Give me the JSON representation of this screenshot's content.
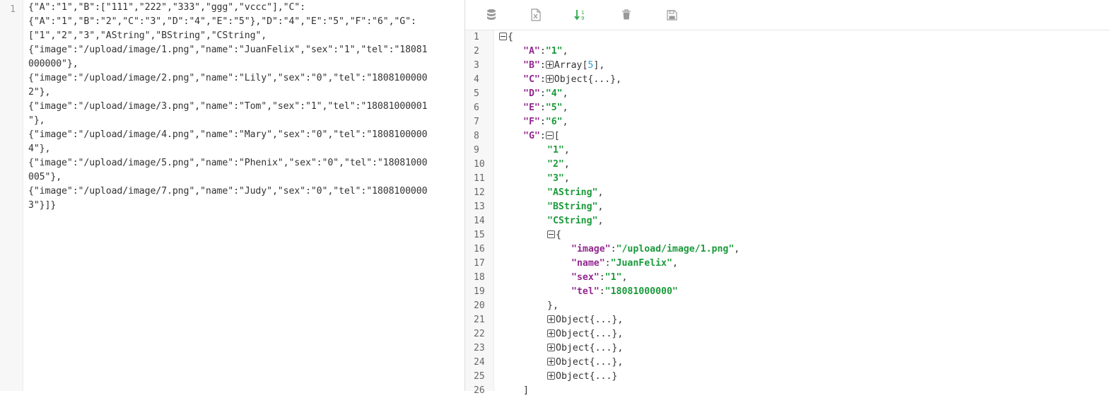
{
  "left_editor": {
    "line_number": "1",
    "rows": [
      "{\"A\":\"1\",\"B\":[\"111\",\"222\",\"333\",\"ggg\",\"vccc\"],\"C\":",
      "{\"A\":\"1\",\"B\":\"2\",\"C\":\"3\",\"D\":\"4\",\"E\":\"5\"},\"D\":\"4\",\"E\":\"5\",\"F\":\"6\",\"G\":",
      "[\"1\",\"2\",\"3\",\"AString\",\"BString\",\"CString\",",
      "{\"image\":\"/upload/image/1.png\",\"name\":\"JuanFelix\",\"sex\":\"1\",\"tel\":\"18081",
      "000000\"},",
      "{\"image\":\"/upload/image/2.png\",\"name\":\"Lily\",\"sex\":\"0\",\"tel\":\"1808100000",
      "2\"},",
      "{\"image\":\"/upload/image/3.png\",\"name\":\"Tom\",\"sex\":\"1\",\"tel\":\"18081000001",
      "\"},",
      "{\"image\":\"/upload/image/4.png\",\"name\":\"Mary\",\"sex\":\"0\",\"tel\":\"1808100000",
      "4\"},",
      "{\"image\":\"/upload/image/5.png\",\"name\":\"Phenix\",\"sex\":\"0\",\"tel\":\"18081000",
      "005\"},",
      "{\"image\":\"/upload/image/7.png\",\"name\":\"Judy\",\"sex\":\"0\",\"tel\":\"1808100000",
      "3\"}]}"
    ]
  },
  "toolbar": {
    "icons": [
      "database-icon",
      "excel-export-icon",
      "sort-icon",
      "trash-icon",
      "save-icon"
    ],
    "accent_color": "#2eaa4a",
    "icon_color": "#999999"
  },
  "colors": {
    "key": "#92278f",
    "string": "#1a9a3a",
    "number": "#25a4d6"
  },
  "tree": {
    "line_numbers": [
      "1",
      "2",
      "3",
      "4",
      "5",
      "6",
      "7",
      "8",
      "9",
      "10",
      "11",
      "12",
      "13",
      "14",
      "15",
      "16",
      "17",
      "18",
      "19",
      "20",
      "21",
      "22",
      "23",
      "24",
      "25",
      "26"
    ],
    "lines": [
      {
        "indent": 0,
        "toggle": "minus",
        "punct": "{"
      },
      {
        "indent": 1,
        "key": "\"A\"",
        "sep": ":",
        "str": "\"1\"",
        "after": ","
      },
      {
        "indent": 1,
        "key": "\"B\"",
        "sep": ":",
        "toggle": "plus",
        "plain": "Array[",
        "num": "5",
        "after": "],"
      },
      {
        "indent": 1,
        "key": "\"C\"",
        "sep": ":",
        "toggle": "plus",
        "plain": "Object{...},"
      },
      {
        "indent": 1,
        "key": "\"D\"",
        "sep": ":",
        "str": "\"4\"",
        "after": ","
      },
      {
        "indent": 1,
        "key": "\"E\"",
        "sep": ":",
        "str": "\"5\"",
        "after": ","
      },
      {
        "indent": 1,
        "key": "\"F\"",
        "sep": ":",
        "str": "\"6\"",
        "after": ","
      },
      {
        "indent": 1,
        "key": "\"G\"",
        "sep": ":",
        "toggle": "minus",
        "punct": "["
      },
      {
        "indent": 2,
        "str": "\"1\"",
        "after": ","
      },
      {
        "indent": 2,
        "str": "\"2\"",
        "after": ","
      },
      {
        "indent": 2,
        "str": "\"3\"",
        "after": ","
      },
      {
        "indent": 2,
        "str": "\"AString\"",
        "after": ","
      },
      {
        "indent": 2,
        "str": "\"BString\"",
        "after": ","
      },
      {
        "indent": 2,
        "str": "\"CString\"",
        "after": ","
      },
      {
        "indent": 2,
        "toggle": "minus",
        "punct": "{"
      },
      {
        "indent": 3,
        "key": "\"image\"",
        "sep": ":",
        "str": "\"/upload/image/1.png\"",
        "after": ","
      },
      {
        "indent": 3,
        "key": "\"name\"",
        "sep": ":",
        "str": "\"JuanFelix\"",
        "after": ","
      },
      {
        "indent": 3,
        "key": "\"sex\"",
        "sep": ":",
        "str": "\"1\"",
        "after": ","
      },
      {
        "indent": 3,
        "key": "\"tel\"",
        "sep": ":",
        "str": "\"18081000000\""
      },
      {
        "indent": 2,
        "punct": "},"
      },
      {
        "indent": 2,
        "toggle": "plus",
        "plain": "Object{...},"
      },
      {
        "indent": 2,
        "toggle": "plus",
        "plain": "Object{...},"
      },
      {
        "indent": 2,
        "toggle": "plus",
        "plain": "Object{...},"
      },
      {
        "indent": 2,
        "toggle": "plus",
        "plain": "Object{...},"
      },
      {
        "indent": 2,
        "toggle": "plus",
        "plain": "Object{...}"
      },
      {
        "indent": 1,
        "punct": "]"
      }
    ]
  }
}
